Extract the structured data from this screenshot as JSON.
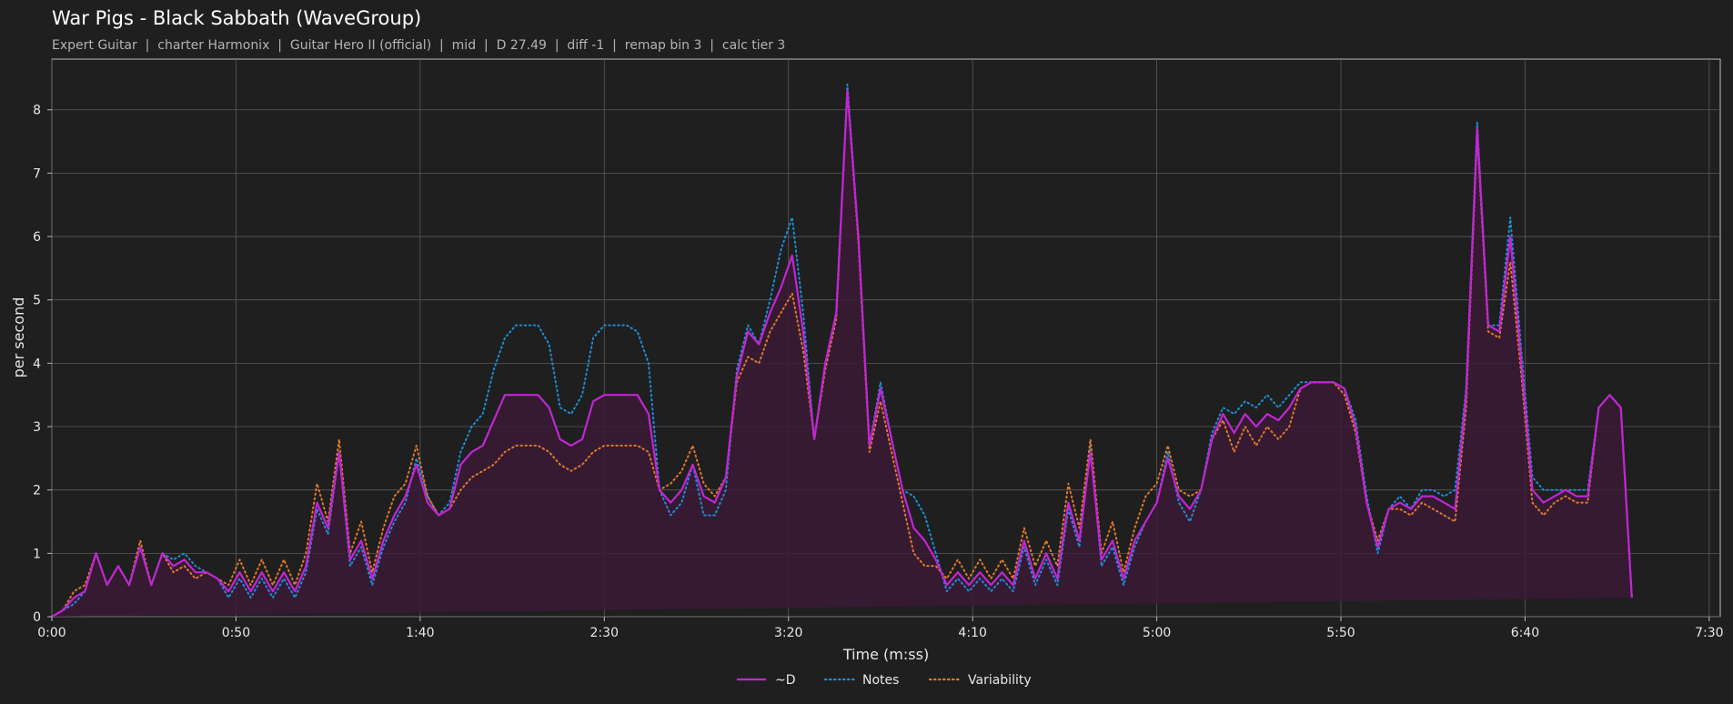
{
  "chart_data": {
    "type": "line",
    "title": "War Pigs - Black Sabbath (WaveGroup)",
    "subtitle": "Expert Guitar  |  charter Harmonix  |  Guitar Hero II (official)  |  mid  |  D 27.49  |  diff -1  |  remap bin 3  |  calc tier 3",
    "xlabel": "Time (m:ss)",
    "ylabel": "per second",
    "xlim": [
      0,
      453
    ],
    "ylim": [
      0,
      8.8
    ],
    "x_ticks": [
      0,
      50,
      100,
      150,
      200,
      250,
      300,
      350,
      400,
      450
    ],
    "x_tick_labels": [
      "0:00",
      "0:50",
      "1:40",
      "2:30",
      "3:20",
      "4:10",
      "5:00",
      "5:50",
      "6:40",
      "7:30"
    ],
    "y_ticks": [
      0,
      1,
      2,
      3,
      4,
      5,
      6,
      7,
      8
    ],
    "y_tick_labels": [
      "0",
      "1",
      "2",
      "3",
      "4",
      "5",
      "6",
      "7",
      "8"
    ],
    "grid": true,
    "legend_position": "bottom-center",
    "x": [
      0,
      3,
      6,
      9,
      12,
      15,
      18,
      21,
      24,
      27,
      30,
      33,
      36,
      39,
      42,
      45,
      48,
      51,
      54,
      57,
      60,
      63,
      66,
      69,
      72,
      75,
      78,
      81,
      84,
      87,
      90,
      93,
      96,
      99,
      102,
      105,
      108,
      111,
      114,
      117,
      120,
      123,
      126,
      129,
      132,
      135,
      138,
      141,
      144,
      147,
      150,
      153,
      156,
      159,
      162,
      165,
      168,
      171,
      174,
      177,
      180,
      183,
      186,
      189,
      192,
      195,
      198,
      201,
      204,
      207,
      210,
      213,
      216,
      219,
      222,
      225,
      228,
      231,
      234,
      237,
      240,
      243,
      246,
      249,
      252,
      255,
      258,
      261,
      264,
      267,
      270,
      273,
      276,
      279,
      282,
      285,
      288,
      291,
      294,
      297,
      300,
      303,
      306,
      309,
      312,
      315,
      318,
      321,
      324,
      327,
      330,
      333,
      336,
      339,
      342,
      345,
      348,
      351,
      354,
      357,
      360,
      363,
      366,
      369,
      372,
      375,
      378,
      381,
      384,
      387,
      390,
      393,
      396,
      399,
      402,
      405,
      408,
      411,
      414,
      417,
      420,
      423,
      426,
      429,
      432,
      435,
      438,
      441,
      444,
      447,
      450,
      453
    ],
    "series": [
      {
        "name": "~D",
        "color": "#c026d3",
        "style": "solid",
        "values": [
          0,
          0.1,
          0.3,
          0.4,
          1.0,
          0.5,
          0.8,
          0.5,
          1.1,
          0.5,
          1.0,
          0.8,
          0.9,
          0.7,
          0.7,
          0.6,
          0.4,
          0.7,
          0.4,
          0.7,
          0.4,
          0.7,
          0.4,
          0.8,
          1.8,
          1.4,
          2.6,
          0.9,
          1.2,
          0.6,
          1.2,
          1.6,
          1.9,
          2.4,
          1.8,
          1.6,
          1.7,
          2.4,
          2.6,
          2.7,
          3.1,
          3.5,
          3.5,
          3.5,
          3.5,
          3.3,
          2.8,
          2.7,
          2.8,
          3.4,
          3.5,
          3.5,
          3.5,
          3.5,
          3.2,
          2.0,
          1.8,
          2.0,
          2.4,
          1.9,
          1.8,
          2.2,
          3.8,
          4.5,
          4.3,
          4.8,
          5.2,
          5.7,
          4.5,
          2.8,
          4.0,
          4.8,
          8.3,
          6.0,
          2.7,
          3.6,
          2.8,
          2.0,
          1.4,
          1.2,
          0.9,
          0.5,
          0.7,
          0.5,
          0.7,
          0.5,
          0.7,
          0.5,
          1.2,
          0.6,
          1.0,
          0.6,
          1.8,
          1.2,
          2.6,
          0.9,
          1.2,
          0.6,
          1.2,
          1.5,
          1.8,
          2.5,
          1.9,
          1.7,
          2.0,
          2.8,
          3.2,
          2.9,
          3.2,
          3.0,
          3.2,
          3.1,
          3.3,
          3.6,
          3.7,
          3.7,
          3.7,
          3.6,
          3.0,
          1.8,
          1.1,
          1.7,
          1.8,
          1.7,
          1.9,
          1.9,
          1.8,
          1.7,
          3.5,
          7.7,
          4.6,
          4.5,
          6.0,
          4.0,
          2.0,
          1.8,
          1.9,
          2.0,
          1.9,
          1.9,
          3.3,
          3.5,
          3.3,
          0.3
        ]
      },
      {
        "name": "Notes",
        "color": "#1f8dd6",
        "style": "dotted",
        "values": [
          0,
          0.1,
          0.2,
          0.4,
          1.0,
          0.5,
          0.8,
          0.5,
          1.1,
          0.5,
          1.0,
          0.9,
          1.0,
          0.8,
          0.7,
          0.6,
          0.3,
          0.6,
          0.3,
          0.6,
          0.3,
          0.6,
          0.3,
          0.7,
          1.7,
          1.3,
          2.6,
          0.8,
          1.1,
          0.5,
          1.1,
          1.5,
          1.8,
          2.5,
          1.9,
          1.6,
          1.8,
          2.6,
          3.0,
          3.2,
          3.9,
          4.4,
          4.6,
          4.6,
          4.6,
          4.3,
          3.3,
          3.2,
          3.5,
          4.4,
          4.6,
          4.6,
          4.6,
          4.5,
          4.0,
          2.0,
          1.6,
          1.8,
          2.4,
          1.6,
          1.6,
          2.0,
          3.9,
          4.6,
          4.3,
          5.0,
          5.8,
          6.3,
          4.8,
          2.8,
          4.0,
          4.8,
          8.4,
          6.0,
          2.7,
          3.7,
          2.8,
          2.0,
          1.9,
          1.6,
          1.0,
          0.4,
          0.6,
          0.4,
          0.6,
          0.4,
          0.6,
          0.4,
          1.1,
          0.5,
          0.9,
          0.5,
          1.7,
          1.1,
          2.7,
          0.8,
          1.1,
          0.5,
          1.1,
          1.5,
          1.8,
          2.6,
          1.8,
          1.5,
          2.0,
          2.9,
          3.3,
          3.2,
          3.4,
          3.3,
          3.5,
          3.3,
          3.5,
          3.7,
          3.7,
          3.7,
          3.7,
          3.6,
          3.1,
          1.9,
          1.0,
          1.7,
          1.9,
          1.7,
          2.0,
          2.0,
          1.9,
          2.0,
          3.6,
          7.8,
          4.6,
          4.6,
          6.3,
          4.2,
          2.2,
          2.0,
          2.0,
          2.0,
          2.0,
          2.0,
          3.3,
          3.5,
          3.3,
          0.3
        ]
      },
      {
        "name": "Variability",
        "color": "#e0782c",
        "style": "dotted",
        "values": [
          0,
          0.1,
          0.4,
          0.5,
          1.0,
          0.5,
          0.8,
          0.5,
          1.2,
          0.5,
          1.0,
          0.7,
          0.8,
          0.6,
          0.7,
          0.6,
          0.5,
          0.9,
          0.5,
          0.9,
          0.5,
          0.9,
          0.5,
          1.0,
          2.1,
          1.5,
          2.8,
          1.0,
          1.5,
          0.7,
          1.4,
          1.9,
          2.1,
          2.7,
          1.9,
          1.6,
          1.7,
          2.0,
          2.2,
          2.3,
          2.4,
          2.6,
          2.7,
          2.7,
          2.7,
          2.6,
          2.4,
          2.3,
          2.4,
          2.6,
          2.7,
          2.7,
          2.7,
          2.7,
          2.6,
          2.0,
          2.1,
          2.3,
          2.7,
          2.1,
          1.9,
          2.2,
          3.7,
          4.1,
          4.0,
          4.5,
          4.8,
          5.1,
          4.2,
          2.8,
          3.9,
          4.7,
          8.3,
          5.9,
          2.6,
          3.4,
          2.6,
          1.8,
          1.0,
          0.8,
          0.8,
          0.6,
          0.9,
          0.6,
          0.9,
          0.6,
          0.9,
          0.6,
          1.4,
          0.8,
          1.2,
          0.8,
          2.1,
          1.4,
          2.8,
          1.0,
          1.5,
          0.7,
          1.4,
          1.9,
          2.1,
          2.7,
          2.0,
          1.9,
          2.0,
          2.8,
          3.1,
          2.6,
          3.0,
          2.7,
          3.0,
          2.8,
          3.0,
          3.6,
          3.7,
          3.7,
          3.7,
          3.5,
          2.9,
          1.8,
          1.2,
          1.7,
          1.7,
          1.6,
          1.8,
          1.7,
          1.6,
          1.5,
          3.3,
          7.6,
          4.5,
          4.4,
          5.6,
          3.8,
          1.8,
          1.6,
          1.8,
          1.9,
          1.8,
          1.8,
          3.3,
          3.5,
          3.3,
          0.3
        ]
      }
    ]
  }
}
